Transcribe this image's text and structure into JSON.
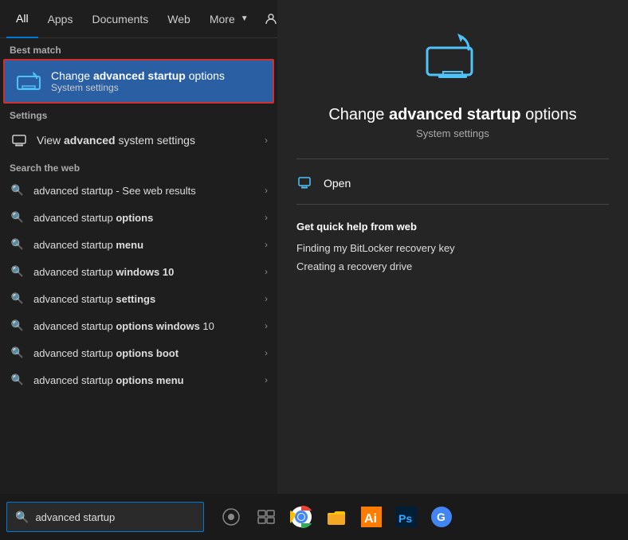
{
  "tabs": {
    "items": [
      {
        "label": "All",
        "active": true
      },
      {
        "label": "Apps",
        "active": false
      },
      {
        "label": "Documents",
        "active": false
      },
      {
        "label": "Web",
        "active": false
      },
      {
        "label": "More",
        "active": false
      }
    ]
  },
  "best_match": {
    "section_label": "Best match",
    "title_prefix": "Change ",
    "title_bold": "advanced startup",
    "title_suffix": " options",
    "subtitle": "System settings"
  },
  "settings": {
    "section_label": "Settings",
    "item_prefix": "View ",
    "item_bold": "advanced",
    "item_suffix": " system settings"
  },
  "web_search": {
    "section_label": "Search the web",
    "items": [
      {
        "prefix": "advanced startup",
        "bold": "",
        "suffix": " - See web results"
      },
      {
        "prefix": "advanced startup ",
        "bold": "options",
        "suffix": ""
      },
      {
        "prefix": "advanced startup ",
        "bold": "menu",
        "suffix": ""
      },
      {
        "prefix": "advanced startup ",
        "bold": "windows 10",
        "suffix": ""
      },
      {
        "prefix": "advanced startup ",
        "bold": "settings",
        "suffix": ""
      },
      {
        "prefix": "advanced startup ",
        "bold": "options windows",
        "suffix": " 10"
      },
      {
        "prefix": "advanced startup ",
        "bold": "options boot",
        "suffix": ""
      },
      {
        "prefix": "advanced startup ",
        "bold": "options menu",
        "suffix": ""
      }
    ]
  },
  "detail": {
    "title_prefix": "Change ",
    "title_bold": "advanced startup",
    "title_suffix": " options",
    "subtitle": "System settings",
    "open_label": "Open",
    "help_title": "Get quick help from web",
    "help_links": [
      "Finding my BitLocker recovery key",
      "Creating a recovery drive"
    ]
  },
  "taskbar": {
    "search_placeholder": "advanced startup",
    "search_icon": "🔍"
  }
}
